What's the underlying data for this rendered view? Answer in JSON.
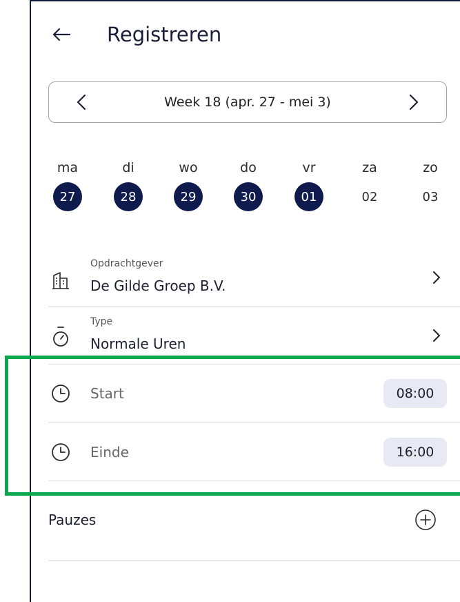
{
  "header": {
    "title": "Registreren",
    "back_icon": "arrow-left-icon"
  },
  "week_nav": {
    "label": "Week 18 (apr. 27 - mei 3)",
    "prev_icon": "chevron-left-icon",
    "next_icon": "chevron-right-icon"
  },
  "days": [
    {
      "name": "ma",
      "num": "27",
      "active": true
    },
    {
      "name": "di",
      "num": "28",
      "active": true
    },
    {
      "name": "wo",
      "num": "29",
      "active": true
    },
    {
      "name": "do",
      "num": "30",
      "active": true
    },
    {
      "name": "vr",
      "num": "01",
      "active": true
    },
    {
      "name": "za",
      "num": "02",
      "active": false
    },
    {
      "name": "zo",
      "num": "03",
      "active": false
    }
  ],
  "client": {
    "caption": "Opdrachtgever",
    "value": "De Gilde Groep B.V.",
    "icon": "building-icon"
  },
  "type": {
    "caption": "Type",
    "value": "Normale Uren",
    "icon": "stopwatch-icon"
  },
  "start": {
    "label": "Start",
    "time": "08:00",
    "icon": "clock-icon"
  },
  "end": {
    "label": "Einde",
    "time": "16:00",
    "icon": "clock-icon"
  },
  "breaks": {
    "label": "Pauzes",
    "add_icon": "plus-circle-icon"
  },
  "colors": {
    "accent_navy": "#0f1a4d",
    "highlight_green": "#0aa84f",
    "pill_bg": "#e8eaf3"
  }
}
